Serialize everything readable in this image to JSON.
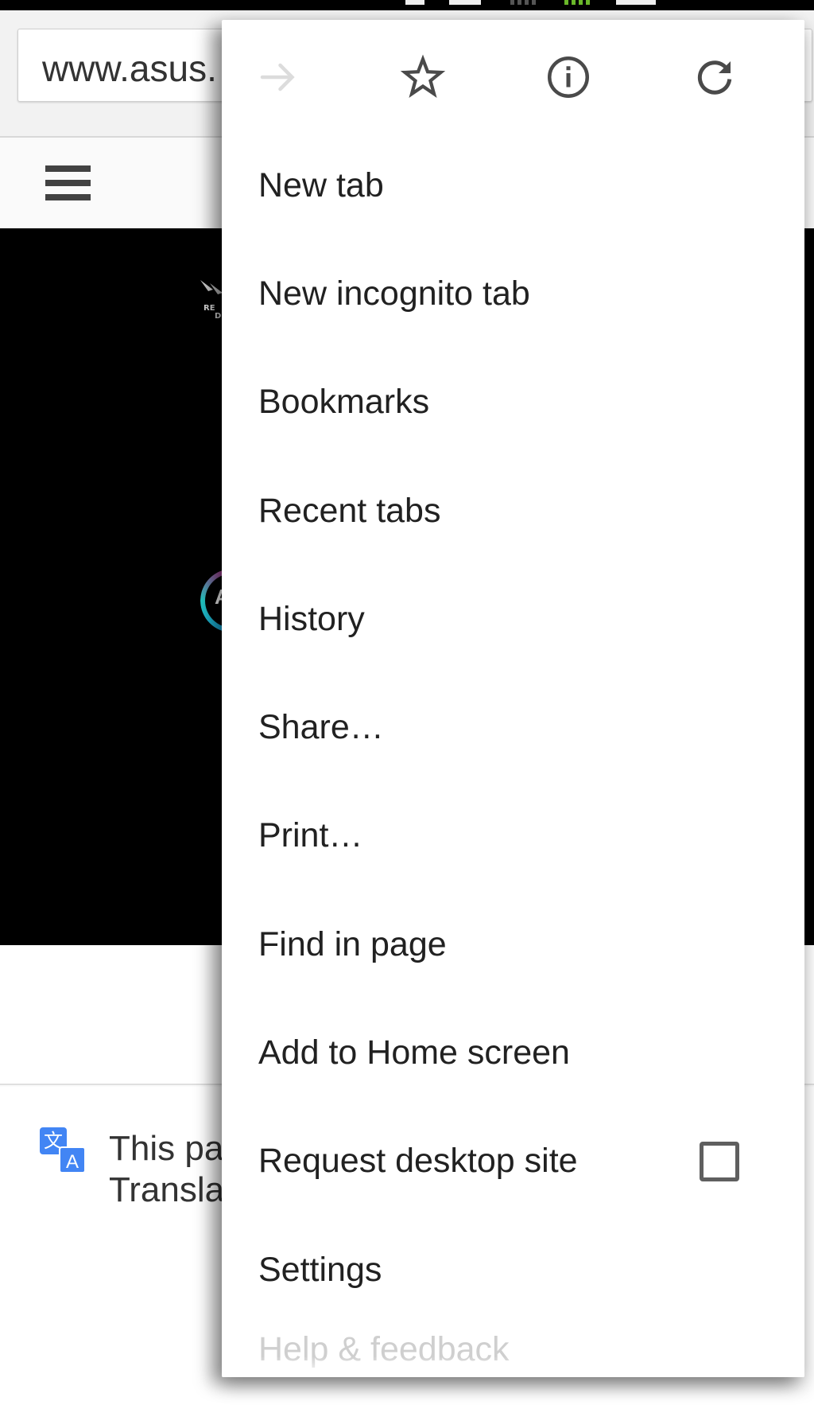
{
  "status_bar": {
    "signal_bars_active_color": "#6ab82a"
  },
  "browser": {
    "omnibox": {
      "url_text": "www.asus."
    }
  },
  "page": {
    "header": {
      "menu_icon": "hamburger-menu-icon"
    },
    "hero": {
      "logo_icon": "rog-logo-icon",
      "aura_letter": "A"
    },
    "translate_bar": {
      "icon": "google-translate-icon",
      "icon_glyph_1": "文",
      "icon_glyph_2": "A",
      "line1": "This pa",
      "line2": "Transla",
      "accent_color": "#4285f4"
    }
  },
  "menu": {
    "icon_row": [
      {
        "name": "forward",
        "icon": "arrow-forward-icon",
        "enabled": false
      },
      {
        "name": "bookmark",
        "icon": "star-outline-icon",
        "enabled": true
      },
      {
        "name": "page-info",
        "icon": "info-icon",
        "enabled": true
      },
      {
        "name": "reload",
        "icon": "reload-icon",
        "enabled": true
      }
    ],
    "items": [
      {
        "label": "New tab"
      },
      {
        "label": "New incognito tab"
      },
      {
        "label": "Bookmarks"
      },
      {
        "label": "Recent tabs"
      },
      {
        "label": "History"
      },
      {
        "label": "Share…"
      },
      {
        "label": "Print…"
      },
      {
        "label": "Find in page"
      },
      {
        "label": "Add to Home screen"
      },
      {
        "label": "Request desktop site",
        "checkbox": true,
        "checked": false
      },
      {
        "label": "Settings"
      },
      {
        "label": "Help & feedback"
      }
    ]
  }
}
